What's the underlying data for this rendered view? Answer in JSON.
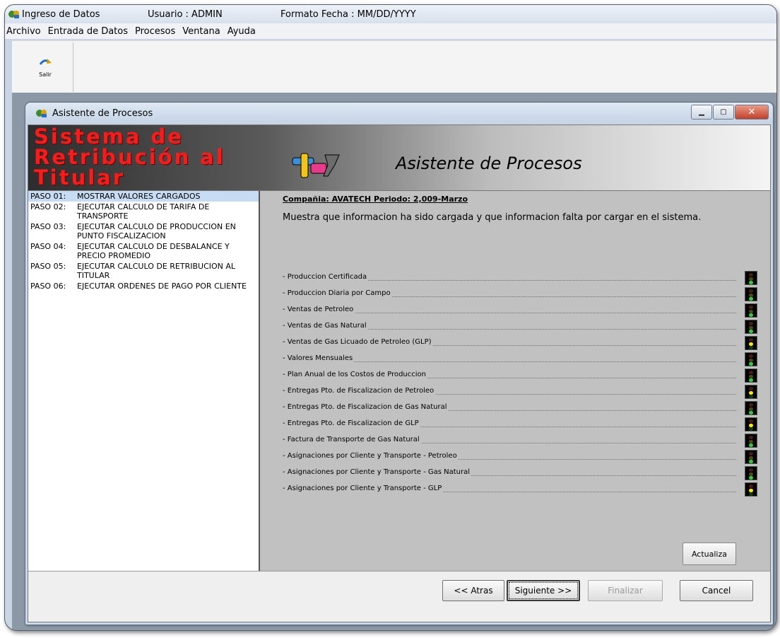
{
  "app": {
    "title": "Ingreso de Datos",
    "user": "Usuario : ADMIN",
    "date_format": "Formato Fecha :  MM/DD/YYYY"
  },
  "menu": [
    "Archivo",
    "Entrada de Datos",
    "Procesos",
    "Ventana",
    "Ayuda"
  ],
  "toolbar": {
    "exit_label": "Salir"
  },
  "child": {
    "title": "Asistente de Procesos"
  },
  "banner": {
    "brand": "Sistema de Retribución al Titular",
    "title": "Asistente de Procesos"
  },
  "steps": [
    {
      "num": "PASO 01:",
      "text": "MOSTRAR VALORES CARGADOS",
      "selected": true
    },
    {
      "num": "PASO 02:",
      "text": "EJECUTAR CALCULO DE TARIFA DE TRANSPORTE"
    },
    {
      "num": "PASO 03:",
      "text": "EJECUTAR CALCULO DE PRODUCCION EN PUNTO FISCALIZACION"
    },
    {
      "num": "PASO 04:",
      "text": "EJECUTAR CALCULO DE DESBALANCE Y PRECIO PROMEDIO"
    },
    {
      "num": "PASO 05:",
      "text": "EJECUTAR CALCULO DE RETRIBUCION AL TITULAR"
    },
    {
      "num": "PASO 06:",
      "text": "EJECUTAR ORDENES DE PAGO POR CLIENTE"
    }
  ],
  "main": {
    "company_period": "Compañia: AVATECH Periodo: 2,009-Marzo",
    "description": "Muestra que informacion ha sido cargada y que informacion falta por cargar en el sistema.",
    "items": [
      {
        "label": "- Produccion Certificada",
        "status": "green"
      },
      {
        "label": "- Produccion Diaria por Campo",
        "status": "green"
      },
      {
        "label": "- Ventas de Petroleo",
        "status": "green"
      },
      {
        "label": "- Ventas de Gas Natural",
        "status": "green"
      },
      {
        "label": "- Ventas de Gas Licuado de Petroleo (GLP)",
        "status": "yellow"
      },
      {
        "label": "- Valores Mensuales",
        "status": "green"
      },
      {
        "label": "- Plan Anual de los Costos de Produccion",
        "status": "green"
      },
      {
        "label": "- Entregas Pto. de Fiscalizacion de Petroleo",
        "status": "yellow"
      },
      {
        "label": "- Entregas Pto. de Fiscalizacion de Gas Natural",
        "status": "green"
      },
      {
        "label": "- Entregas Pto. de Fiscalizacion de GLP",
        "status": "yellow"
      },
      {
        "label": "- Factura de Transporte de Gas Natural",
        "status": "green"
      },
      {
        "label": "- Asignaciones por Cliente y Transporte - Petroleo",
        "status": "green"
      },
      {
        "label": "- Asignaciones por Cliente y Transporte - Gas Natural",
        "status": "green"
      },
      {
        "label": "- Asignaciones por Cliente y Transporte - GLP",
        "status": "yellow"
      }
    ],
    "refresh_label": "Actualiza"
  },
  "footer": {
    "back": "<< Atras",
    "next": "Siguiente >>",
    "finish": "Finalizar",
    "cancel": "Cancel"
  },
  "colors": {
    "brand_red": "#ff1a1a",
    "selected_step": "#c7dcf2",
    "panel_gray": "#c1c1c1",
    "light_green": "#2ecc40",
    "light_yellow": "#ffe600"
  }
}
